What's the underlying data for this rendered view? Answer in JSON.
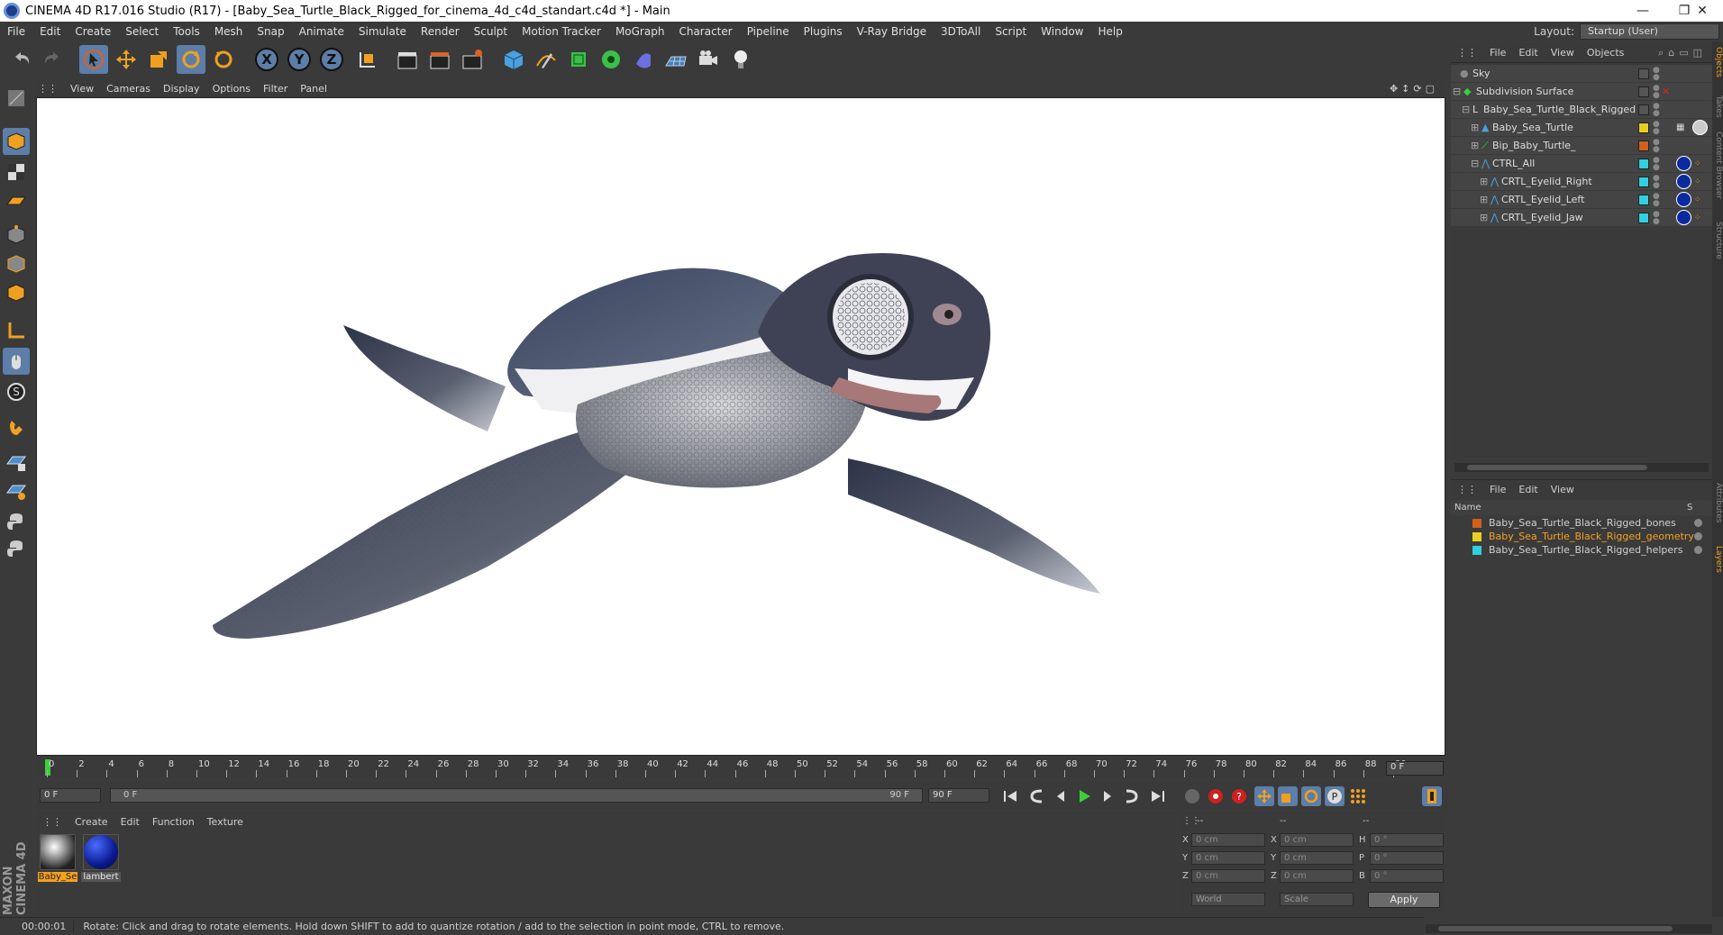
{
  "title_bar": {
    "title": "CINEMA 4D R17.016 Studio (R17) - [Baby_Sea_Turtle_Black_Rigged_for_cinema_4d_c4d_standart.c4d *] - Main",
    "minimize": "—",
    "restore": "❐",
    "close": "✕"
  },
  "menu": [
    "File",
    "Edit",
    "Create",
    "Select",
    "Tools",
    "Mesh",
    "Snap",
    "Animate",
    "Simulate",
    "Render",
    "Sculpt",
    "Motion Tracker",
    "MoGraph",
    "Character",
    "Pipeline",
    "Plugins",
    "V-Ray Bridge",
    "3DToAll",
    "Script",
    "Window",
    "Help"
  ],
  "layout": {
    "label": "Layout:",
    "value": "Startup (User)"
  },
  "toolbar": {
    "x": "X",
    "y": "Y",
    "z": "Z"
  },
  "viewport_menu": [
    "View",
    "Cameras",
    "Display",
    "Options",
    "Filter",
    "Panel"
  ],
  "timeline": {
    "ticks": [
      "0",
      "2",
      "4",
      "6",
      "8",
      "10",
      "12",
      "14",
      "16",
      "18",
      "20",
      "22",
      "24",
      "26",
      "28",
      "30",
      "32",
      "34",
      "36",
      "38",
      "40",
      "42",
      "44",
      "46",
      "48",
      "50",
      "52",
      "54",
      "56",
      "58",
      "60",
      "62",
      "64",
      "66",
      "68",
      "70",
      "72",
      "74",
      "76",
      "78",
      "80",
      "82",
      "84",
      "86",
      "88",
      "90"
    ],
    "current_frame": "0 F",
    "start_field": "0 F",
    "range_start": "0 F",
    "range_end": "90 F",
    "end_field": "90 F"
  },
  "material_manager": {
    "menu": [
      "Create",
      "Edit",
      "Function",
      "Texture"
    ],
    "materials": [
      {
        "label": "Baby_Se",
        "selected": true
      },
      {
        "label": "lambert",
        "selected": false
      }
    ]
  },
  "coordinates": {
    "header": [
      "--",
      "--",
      "--"
    ],
    "rows": [
      {
        "a": "X",
        "av": "0 cm",
        "b": "X",
        "bv": "0 cm",
        "c": "H",
        "cv": "0 °"
      },
      {
        "a": "Y",
        "av": "0 cm",
        "b": "Y",
        "bv": "0 cm",
        "c": "P",
        "cv": "0 °"
      },
      {
        "a": "Z",
        "av": "0 cm",
        "b": "Z",
        "bv": "0 cm",
        "c": "B",
        "cv": "0 °"
      }
    ],
    "world": "World",
    "scale": "Scale",
    "apply": "Apply"
  },
  "status": {
    "time": "00:00:01",
    "message": "Rotate: Click and drag to rotate elements. Hold down SHIFT to add to quantize rotation / add to the selection in point mode, CTRL to remove."
  },
  "maxon": "MAXON CINEMA 4D",
  "object_manager": {
    "menu": [
      "File",
      "Edit",
      "View",
      "Objects"
    ],
    "objects": [
      {
        "name": "Sky",
        "indent": 0,
        "color": "#3a3a3a",
        "tag": false
      },
      {
        "name": "Subdivision Surface",
        "indent": 0,
        "color": "#3a3a3a",
        "tag": false
      },
      {
        "name": "Baby_Sea_Turtle_Black_Rigged",
        "indent": 1,
        "color": "#3a3a3a",
        "tag": false
      },
      {
        "name": "Baby_Sea_Turtle",
        "indent": 2,
        "color": "#e8d020",
        "tag": false
      },
      {
        "name": "Bip_Baby_Turtle_",
        "indent": 2,
        "color": "#d0601a",
        "tag": false
      },
      {
        "name": "CTRL_All",
        "indent": 2,
        "color": "#30d0e0",
        "tag": true
      },
      {
        "name": "CRTL_Eyelid_Right",
        "indent": 3,
        "color": "#30d0e0",
        "tag": true
      },
      {
        "name": "CRTL_Eyelid_Left",
        "indent": 3,
        "color": "#30d0e0",
        "tag": true
      },
      {
        "name": "CRTL_Eyelid_Jaw",
        "indent": 3,
        "color": "#30d0e0",
        "tag": true
      }
    ]
  },
  "layer_manager": {
    "menu": [
      "File",
      "Edit",
      "View"
    ],
    "header_name": "Name",
    "header_s": "S",
    "layers": [
      {
        "name": "Baby_Sea_Turtle_Black_Rigged_bones",
        "color": "#d0601a",
        "highlight": false
      },
      {
        "name": "Baby_Sea_Turtle_Black_Rigged_geometry",
        "color": "#e8d020",
        "highlight": true
      },
      {
        "name": "Baby_Sea_Turtle_Black_Rigged_helpers",
        "color": "#30d0e0",
        "highlight": false
      }
    ]
  },
  "right_tabs": [
    "Objects",
    "Takes",
    "Content Browser",
    "Structure",
    "Attributes",
    "Layers"
  ],
  "colors": {
    "accent": "#5c7ea8",
    "highlight": "#f4a020"
  }
}
